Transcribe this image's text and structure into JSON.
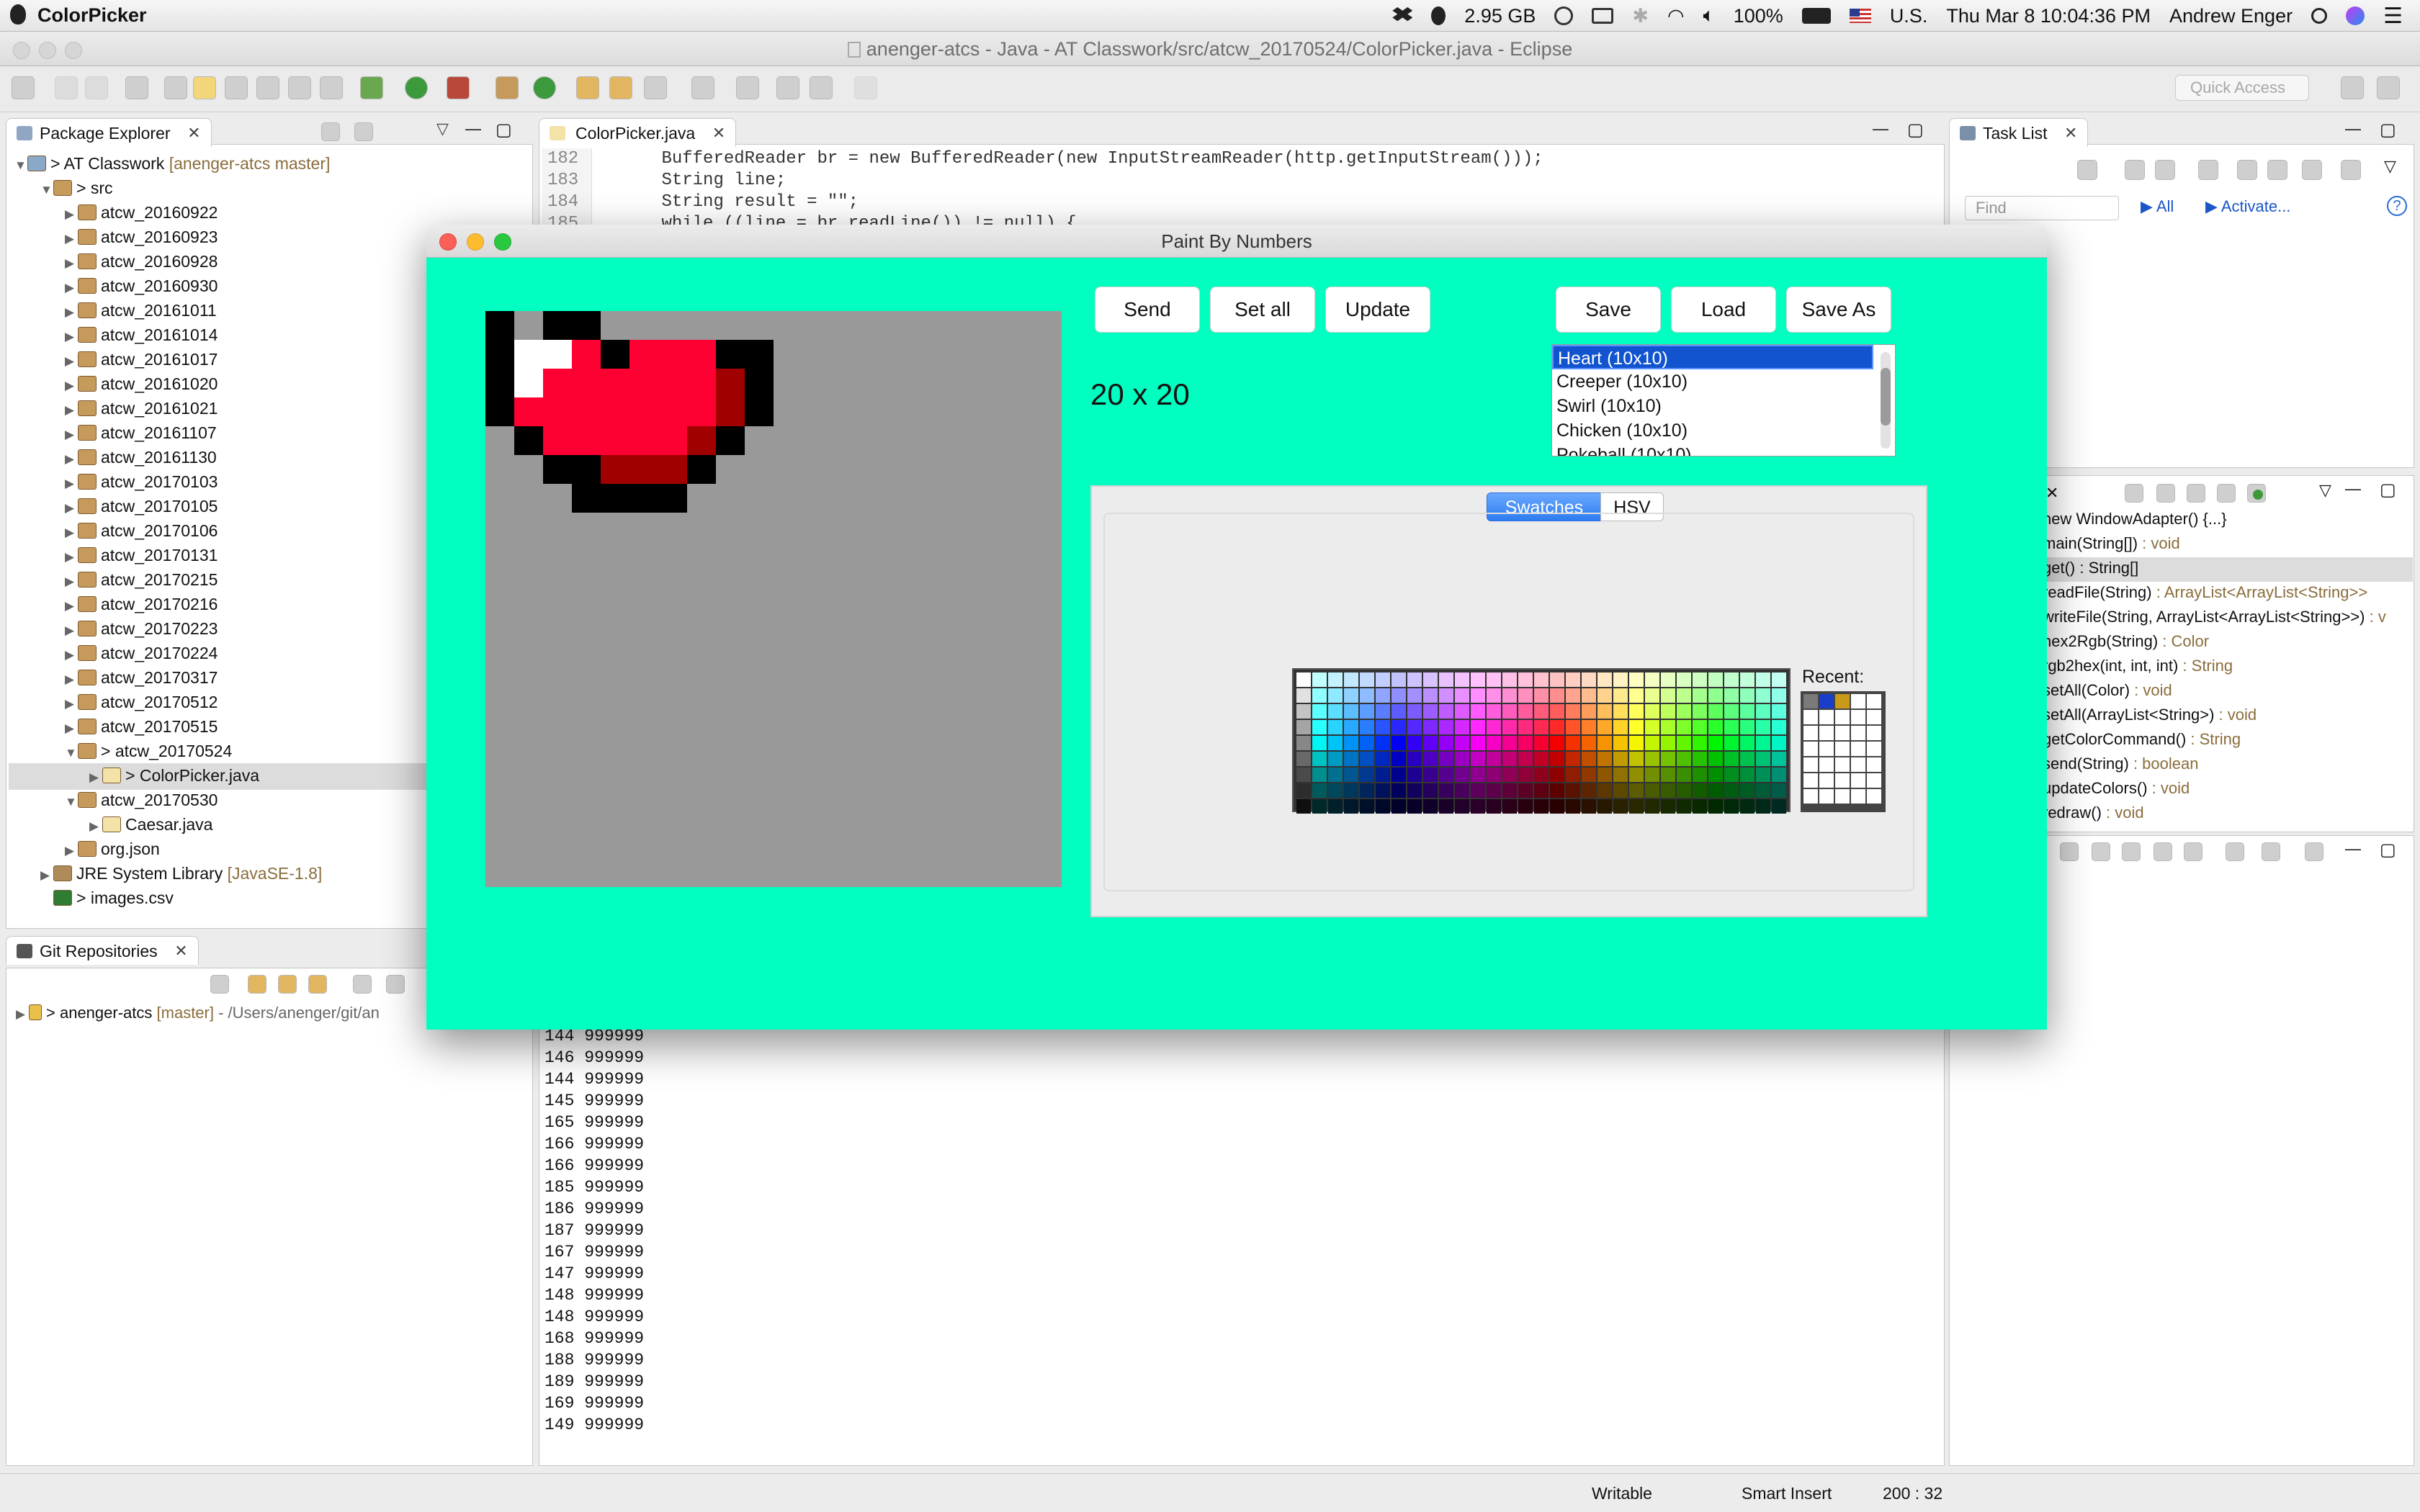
{
  "menubar": {
    "app_name": "ColorPicker",
    "memory": "2.95 GB",
    "battery": "100%",
    "input_source": "U.S.",
    "datetime": "Thu Mar 8  10:04:36 PM",
    "user": "Andrew Enger"
  },
  "eclipse": {
    "window_title": "anenger-atcs - Java - AT Classwork/src/atcw_20170524/ColorPicker.java - Eclipse",
    "quick_access_placeholder": "Quick Access",
    "package_explorer": {
      "tab": "Package Explorer",
      "project": "AT Classwork",
      "project_repo": "[anenger-atcs master]",
      "src": "src",
      "packages": [
        "atcw_20160922",
        "atcw_20160923",
        "atcw_20160928",
        "atcw_20160930",
        "atcw_20161011",
        "atcw_20161014",
        "atcw_20161017",
        "atcw_20161020",
        "atcw_20161021",
        "atcw_20161107",
        "atcw_20161130",
        "atcw_20170103",
        "atcw_20170105",
        "atcw_20170106",
        "atcw_20170131",
        "atcw_20170215",
        "atcw_20170216",
        "atcw_20170223",
        "atcw_20170224",
        "atcw_20170317",
        "atcw_20170512",
        "atcw_20170515"
      ],
      "open_package": "atcw_20170524",
      "open_file": "ColorPicker.java",
      "package_0530": "atcw_20170530",
      "caesar": "Caesar.java",
      "org_json": "org.json",
      "jre": "JRE System Library",
      "jre_version": "[JavaSE-1.8]",
      "images_csv": "images.csv"
    },
    "git": {
      "tab": "Git Repositories",
      "repo": "anenger-atcs",
      "branch": "[master]",
      "path": "- /Users/anenger/git/an"
    },
    "editor": {
      "tab": "ColorPicker.java",
      "lines": [
        {
          "num": "182",
          "code": "        BufferedReader br = new BufferedReader(new InputStreamReader(http.getInputStream()));"
        },
        {
          "num": "183",
          "code": "        String line;"
        },
        {
          "num": "184",
          "code": "        String result = \"\";"
        },
        {
          "num": "185",
          "code": "        while ((line = br.readLine()) != null) {"
        }
      ]
    },
    "task_list": {
      "tab": "Task List",
      "find_placeholder": "Find",
      "all": "All",
      "activate": "Activate..."
    },
    "outline": [
      {
        "name": "new WindowAdapter() {...}",
        "type": ""
      },
      {
        "name": "main(String[])",
        "type": " : void"
      },
      {
        "name": "get() : String[]",
        "type": ""
      },
      {
        "name": "readFile(String)",
        "type": " : ArrayList<ArrayList<String>>"
      },
      {
        "name": "writeFile(String, ArrayList<ArrayList<String>>)",
        "type": " : v"
      },
      {
        "name": "hex2Rgb(String)",
        "type": " : Color"
      },
      {
        "name": "rgb2hex(int, int, int)",
        "type": " : String"
      },
      {
        "name": "setAll(Color)",
        "type": " : void"
      },
      {
        "name": "setAll(ArrayList<String>)",
        "type": " : void"
      },
      {
        "name": "getColorCommand()",
        "type": " : String"
      },
      {
        "name": "send(String)",
        "type": " : boolean"
      },
      {
        "name": "updateColors()",
        "type": " : void"
      },
      {
        "name": "redraw()",
        "type": " : void"
      }
    ],
    "console": [
      {
        "a": "144",
        "b": "999999"
      },
      {
        "a": "146",
        "b": "999999"
      },
      {
        "a": "144",
        "b": "999999"
      },
      {
        "a": "145",
        "b": "999999"
      },
      {
        "a": "165",
        "b": "999999"
      },
      {
        "a": "166",
        "b": "999999"
      },
      {
        "a": "166",
        "b": "999999"
      },
      {
        "a": "185",
        "b": "999999"
      },
      {
        "a": "186",
        "b": "999999"
      },
      {
        "a": "187",
        "b": "999999"
      },
      {
        "a": "167",
        "b": "999999"
      },
      {
        "a": "147",
        "b": "999999"
      },
      {
        "a": "148",
        "b": "999999"
      },
      {
        "a": "148",
        "b": "999999"
      },
      {
        "a": "168",
        "b": "999999"
      },
      {
        "a": "188",
        "b": "999999"
      },
      {
        "a": "189",
        "b": "999999"
      },
      {
        "a": "169",
        "b": "999999"
      },
      {
        "a": "149",
        "b": "999999"
      }
    ],
    "status": {
      "writable": "Writable",
      "insert_mode": "Smart Insert",
      "position": "200 : 32"
    }
  },
  "paint": {
    "title": "Paint By Numbers",
    "background": "#00ffc0",
    "buttons": {
      "send": "Send",
      "set_all": "Set all",
      "update": "Update",
      "save": "Save",
      "load": "Load",
      "save_as": "Save As"
    },
    "dimensions": "20 x 20",
    "images": [
      "Heart (10x10)",
      "Creeper (10x10)",
      "Swirl (10x10)",
      "Chicken (10x10)",
      "Pokeball (10x10)"
    ],
    "selected_image": 0,
    "chooser_tabs": [
      "Swatches",
      "HSV"
    ],
    "active_chooser_tab": "Swatches",
    "recent_label": "Recent:",
    "recent_colors": [
      "#7a7a7a",
      "#1a3ec9",
      "#c99a1a"
    ],
    "pixel_rows": [
      "k1kk11",
      "kwwrkrrrkk",
      "kwrrrrrrdk",
      "krrrrrrrdk",
      "1krrrrrdk",
      "11kkdddk",
      "111kkkk"
    ]
  }
}
